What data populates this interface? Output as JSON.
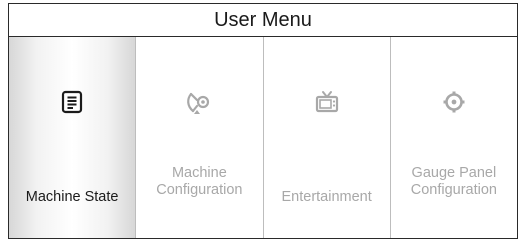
{
  "menu": {
    "title": "User Menu",
    "items": [
      {
        "lines": [
          "Machine State"
        ],
        "icon": "document-list-icon",
        "active": true
      },
      {
        "lines": [
          "Machine",
          "Configuration"
        ],
        "icon": "satellite-dish-icon",
        "active": false
      },
      {
        "lines": [
          "Entertainment"
        ],
        "icon": "tv-icon",
        "active": false
      },
      {
        "lines": [
          "Gauge Panel",
          "Configuration"
        ],
        "icon": "gear-icon",
        "active": false
      }
    ]
  },
  "colors": {
    "active_text": "#1b1b1b",
    "inactive_text": "#a8a8a8",
    "border": "#2a2a2a"
  }
}
